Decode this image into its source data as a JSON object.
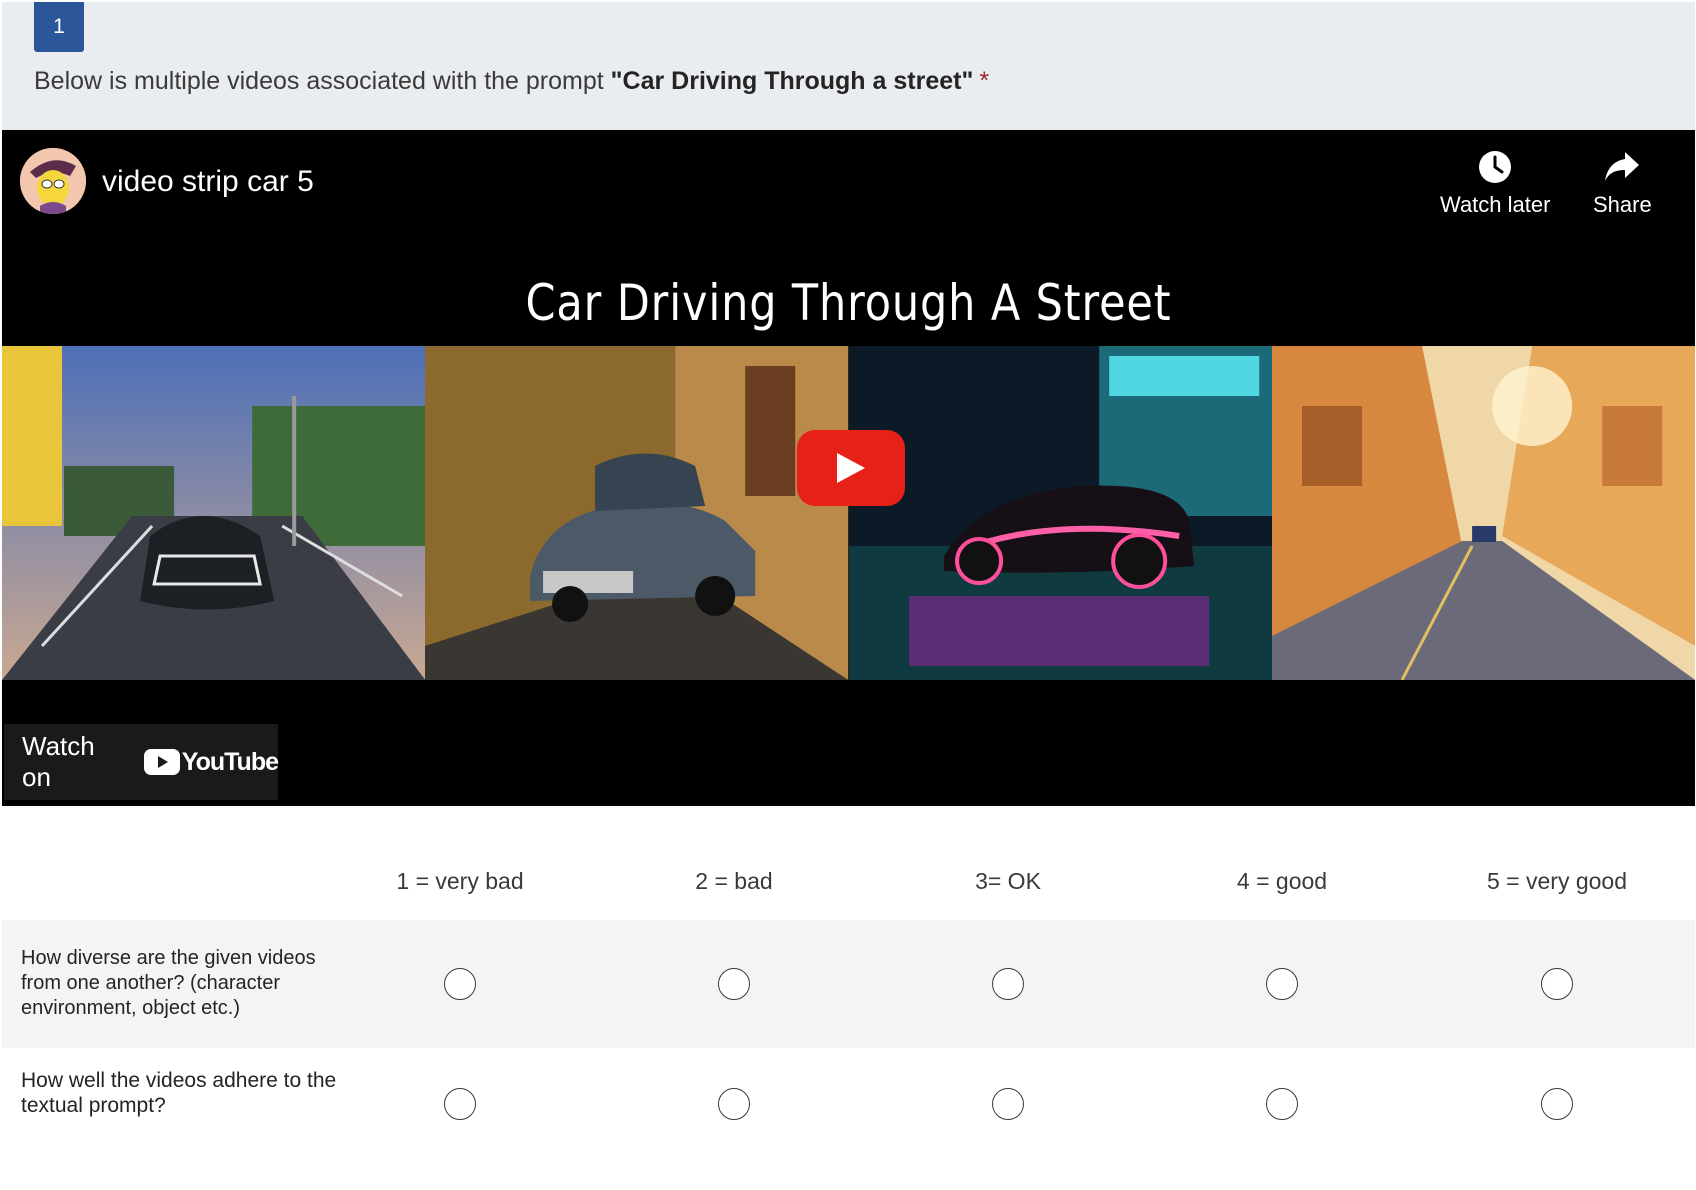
{
  "question": {
    "number": "1",
    "text_prefix": "Below is multiple videos associated with the prompt ",
    "prompt": "\"Car Driving Through a street\"",
    "required_mark": "*"
  },
  "video": {
    "title": "video strip car 5",
    "watch_later_label": "Watch later",
    "share_label": "Share",
    "strip_title": "Car Driving Through A Street",
    "watch_on_label": "Watch on",
    "youtube_label": "YouTube",
    "colors": {
      "play_button": "#e62117",
      "background": "#000000"
    }
  },
  "rating": {
    "columns": [
      "1 = very bad",
      "2 = bad",
      "3=  OK",
      "4 = good",
      "5 = very good"
    ],
    "rows": [
      "How diverse are the given videos from one another? (character environment, object etc.)",
      "How well the videos adhere to the textual prompt?"
    ]
  }
}
